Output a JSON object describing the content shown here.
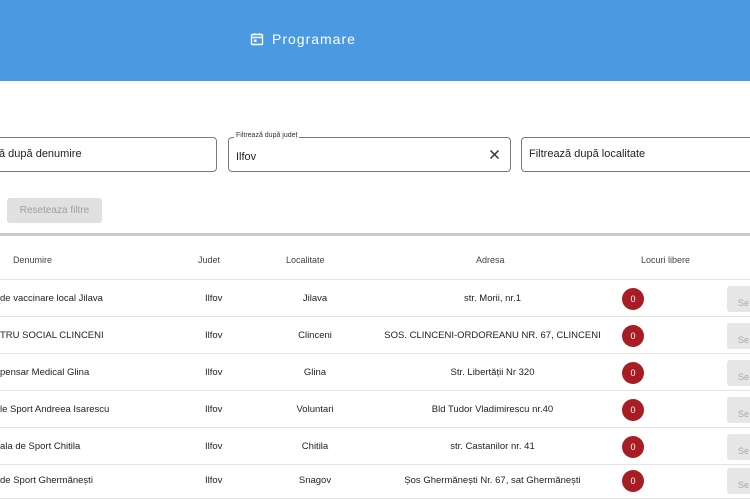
{
  "header": {
    "title": "Programare"
  },
  "filters": {
    "name_filter": {
      "value": "ă după denumire"
    },
    "county_filter": {
      "label": "Filtrează după județ",
      "value": "Ilfov"
    },
    "city_filter": {
      "value": "Filtrează după localitate"
    },
    "reset_label": "Reseteaza filtre"
  },
  "table": {
    "columns": [
      "Denumire",
      "Judet",
      "Localitate",
      "Adresa",
      "Locuri libere"
    ],
    "rows": [
      {
        "denumire": " de vaccinare local Jilava",
        "judet": "Ilfov",
        "localitate": "Jilava",
        "adresa": "str. Morii, nr.1",
        "locuri": "0",
        "action": "Se"
      },
      {
        "denumire": "TRU SOCIAL CLINCENI",
        "judet": "Ilfov",
        "localitate": "Clinceni",
        "adresa": "SOS. CLINCENI-ORDOREANU NR. 67, CLINCENI",
        "locuri": "0",
        "action": "Se"
      },
      {
        "denumire": "pensar Medical Glina",
        "judet": "Ilfov",
        "localitate": "Glina",
        "adresa": "Str. Libertății Nr 320",
        "locuri": "0",
        "action": "Se"
      },
      {
        "denumire": "le Sport Andreea Isarescu",
        "judet": "Ilfov",
        "localitate": "Voluntari",
        "adresa": "Bld Tudor Vladimirescu nr.40",
        "locuri": "0",
        "action": "Se"
      },
      {
        "denumire": "ala de Sport Chitila",
        "judet": "Ilfov",
        "localitate": "Chitila",
        "adresa": "str. Castanilor nr. 41",
        "locuri": "0",
        "action": "Se"
      },
      {
        "denumire": " de Sport Ghermănești",
        "judet": "Ilfov",
        "localitate": "Snagov",
        "adresa": "Șos Ghermănești Nr. 67, sat Ghermănești",
        "locuri": "0",
        "action": "Se"
      }
    ]
  },
  "colors": {
    "header_bg": "#4a9ae2",
    "badge": "#a81d23"
  }
}
